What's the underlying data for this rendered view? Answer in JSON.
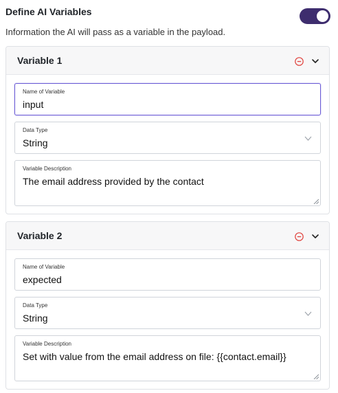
{
  "section": {
    "title": "Define AI Variables",
    "description": "Information the AI will pass as a variable in the payload.",
    "toggle_on": true
  },
  "variables": [
    {
      "title": "Variable 1",
      "name_label": "Name of Variable",
      "name_value": "input",
      "type_label": "Data Type",
      "type_value": "String",
      "desc_label": "Variable Description",
      "desc_value": "The email address provided by the contact"
    },
    {
      "title": "Variable 2",
      "name_label": "Name of Variable",
      "name_value": "expected",
      "type_label": "Data Type",
      "type_value": "String",
      "desc_label": "Variable Description",
      "desc_value": "Set with value from the email address on file: {{contact.email}}"
    }
  ],
  "icons": {
    "remove": "minus-circle-icon",
    "collapse": "chevron-down-icon",
    "select": "chevron-down-icon"
  },
  "colors": {
    "toggle_on": "#3e2d6e",
    "remove_icon": "#e0413c",
    "focus_border": "#6b5bd6"
  }
}
